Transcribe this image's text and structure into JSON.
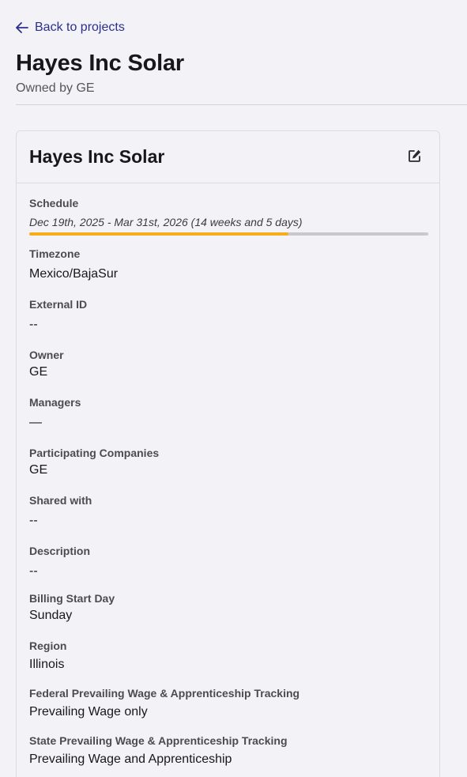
{
  "nav": {
    "back_label": "Back to projects"
  },
  "header": {
    "title": "Hayes Inc Solar",
    "subtitle": "Owned by GE"
  },
  "card": {
    "title": "Hayes Inc Solar",
    "schedule": {
      "label": "Schedule",
      "text": "Dec 19th, 2025 - Mar 31st, 2026 (14 weeks and 5 days)",
      "progress_fraction": 0.65
    },
    "fields": [
      {
        "label": "Timezone",
        "value": "Mexico/BajaSur"
      },
      {
        "label": "External ID",
        "value": "--"
      },
      {
        "label": "Owner",
        "value": "GE"
      },
      {
        "label": "Managers",
        "value": "—"
      },
      {
        "label": "Participating Companies",
        "value": "GE"
      },
      {
        "label": "Shared with",
        "value": "--"
      },
      {
        "label": "Description",
        "value": "--"
      },
      {
        "label": "Billing Start Day",
        "value": "Sunday"
      },
      {
        "label": "Region",
        "value": "Illinois"
      },
      {
        "label": "Federal Prevailing Wage & Apprenticeship Tracking",
        "value": "Prevailing Wage only"
      },
      {
        "label": "State Prevailing Wage & Apprenticeship Tracking",
        "value": "Prevailing Wage and Apprenticeship"
      }
    ]
  },
  "colors": {
    "link": "#2b2f8f",
    "progress": "#f5ad1b",
    "track": "#c9c8cd",
    "background": "#f3f2f6"
  },
  "icons": {
    "back": "arrow-left-icon",
    "edit": "edit-icon"
  }
}
